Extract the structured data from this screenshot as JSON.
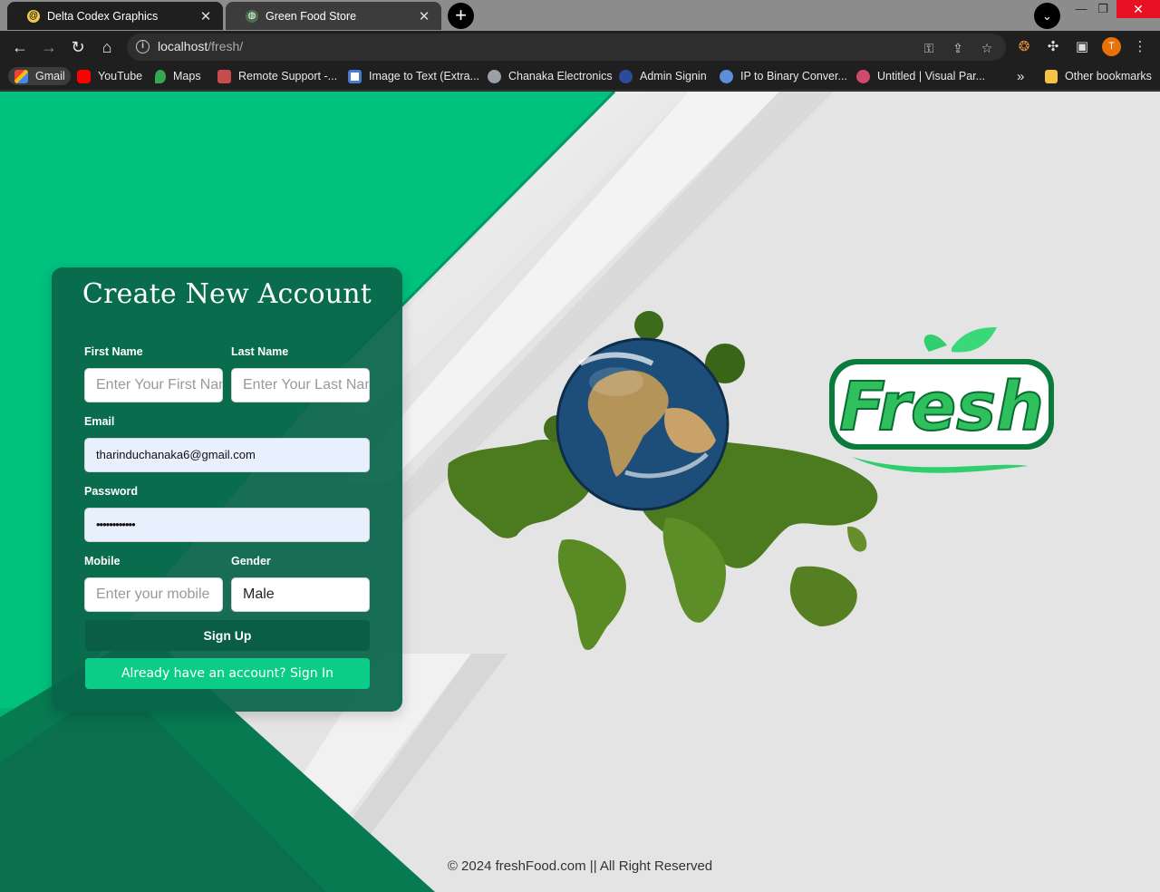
{
  "browser": {
    "tabs": [
      {
        "title": "Delta Codex Graphics",
        "active": true
      },
      {
        "title": "Green Food Store",
        "active": false
      }
    ],
    "url_host": "localhost",
    "url_path": "/fresh/",
    "profile_initial": "T",
    "bookmarks": [
      {
        "label": "Gmail",
        "icon": "gmail-icon",
        "color": "#ea4335"
      },
      {
        "label": "YouTube",
        "icon": "youtube-icon",
        "color": "#ff0000"
      },
      {
        "label": "Maps",
        "icon": "maps-icon",
        "color": "#34a853"
      },
      {
        "label": "Remote Support -...",
        "icon": "remote-support-icon",
        "color": "#c94c4c"
      },
      {
        "label": "Image to Text (Extra...",
        "icon": "image-to-text-icon",
        "color": "#4a7bd0"
      },
      {
        "label": "Chanaka Electronics",
        "icon": "globe-icon",
        "color": "#9aa0a6"
      },
      {
        "label": "Admin Signin",
        "icon": "admin-icon",
        "color": "#2b4c9a"
      },
      {
        "label": "IP to Binary Conver...",
        "icon": "ip-binary-icon",
        "color": "#5b8fd9"
      },
      {
        "label": "Untitled | Visual Par...",
        "icon": "visual-paradigm-icon",
        "color": "#d04a6a"
      }
    ],
    "overflow_label": "»",
    "other_bookmarks": "Other bookmarks"
  },
  "form": {
    "title": "Create New Account",
    "first_name_label": "First Name",
    "first_name_placeholder": "Enter Your First Name",
    "last_name_label": "Last Name",
    "last_name_placeholder": "Enter Your Last Name",
    "email_label": "Email",
    "email_value": "tharinduchanaka6@gmail.com",
    "password_label": "Password",
    "password_value": "••••••••••••",
    "mobile_label": "Mobile",
    "mobile_placeholder": "Enter your mobile",
    "gender_label": "Gender",
    "gender_value": "Male",
    "signup_label": "Sign Up",
    "signin_label": "Already have an account? Sign In"
  },
  "logo": {
    "text": "Fresh"
  },
  "footer": {
    "text": "© 2024 freshFood.com || All Right Reserved"
  },
  "colors": {
    "brand_green": "#00c17e",
    "dark_green": "#096549",
    "signin_button": "#0ccd87"
  }
}
